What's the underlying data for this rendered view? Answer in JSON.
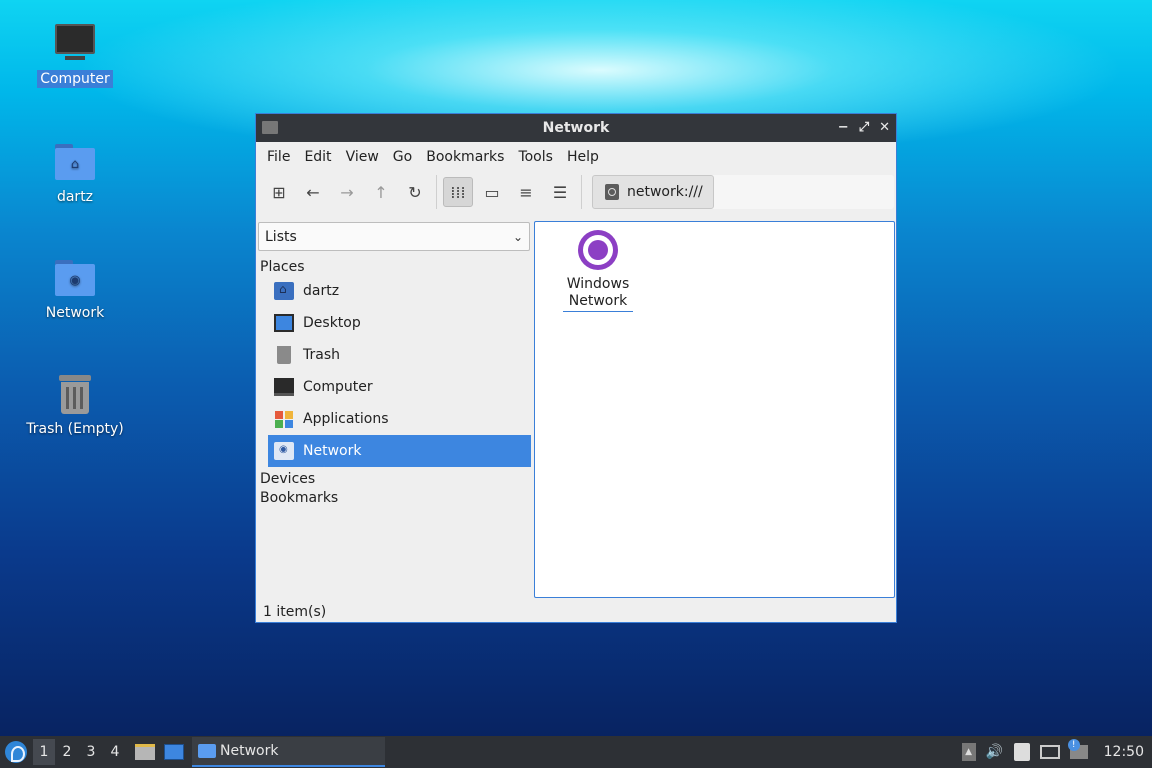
{
  "desktop": {
    "icons": [
      {
        "label": "Computer"
      },
      {
        "label": "dartz"
      },
      {
        "label": "Network"
      },
      {
        "label": "Trash (Empty)"
      }
    ]
  },
  "window": {
    "title": "Network",
    "controls": {
      "minimize": "−",
      "maximize": "⤢",
      "close": "✕"
    },
    "menu": [
      "File",
      "Edit",
      "View",
      "Go",
      "Bookmarks",
      "Tools",
      "Help"
    ],
    "toolbar": {
      "new_tab_icon": "⊞",
      "back_icon": "←",
      "forward_icon": "→",
      "up_icon": "↑",
      "reload_icon": "↻",
      "icon_view": "⁞⁞⁞",
      "thumb_view": "▭",
      "compact_view": "≡",
      "detail_view": "☰"
    },
    "location": "network:///",
    "side_mode": "Lists",
    "sections": {
      "places": "Places",
      "devices": "Devices",
      "bookmarks": "Bookmarks"
    },
    "places": [
      {
        "label": "dartz"
      },
      {
        "label": "Desktop"
      },
      {
        "label": "Trash"
      },
      {
        "label": "Computer"
      },
      {
        "label": "Applications"
      },
      {
        "label": "Network"
      }
    ],
    "items": [
      {
        "label_line1": "Windows",
        "label_line2": "Network"
      }
    ],
    "status": "1 item(s)"
  },
  "taskbar": {
    "workspaces": [
      "1",
      "2",
      "3",
      "4"
    ],
    "task_label": "Network",
    "clock": "12:50",
    "volume_icon": "🔊"
  },
  "colors": {
    "accent": "#3d86e0",
    "titlebar": "#33363b",
    "taskbar": "#2d3035",
    "net_icon": "#8c3fc4"
  }
}
